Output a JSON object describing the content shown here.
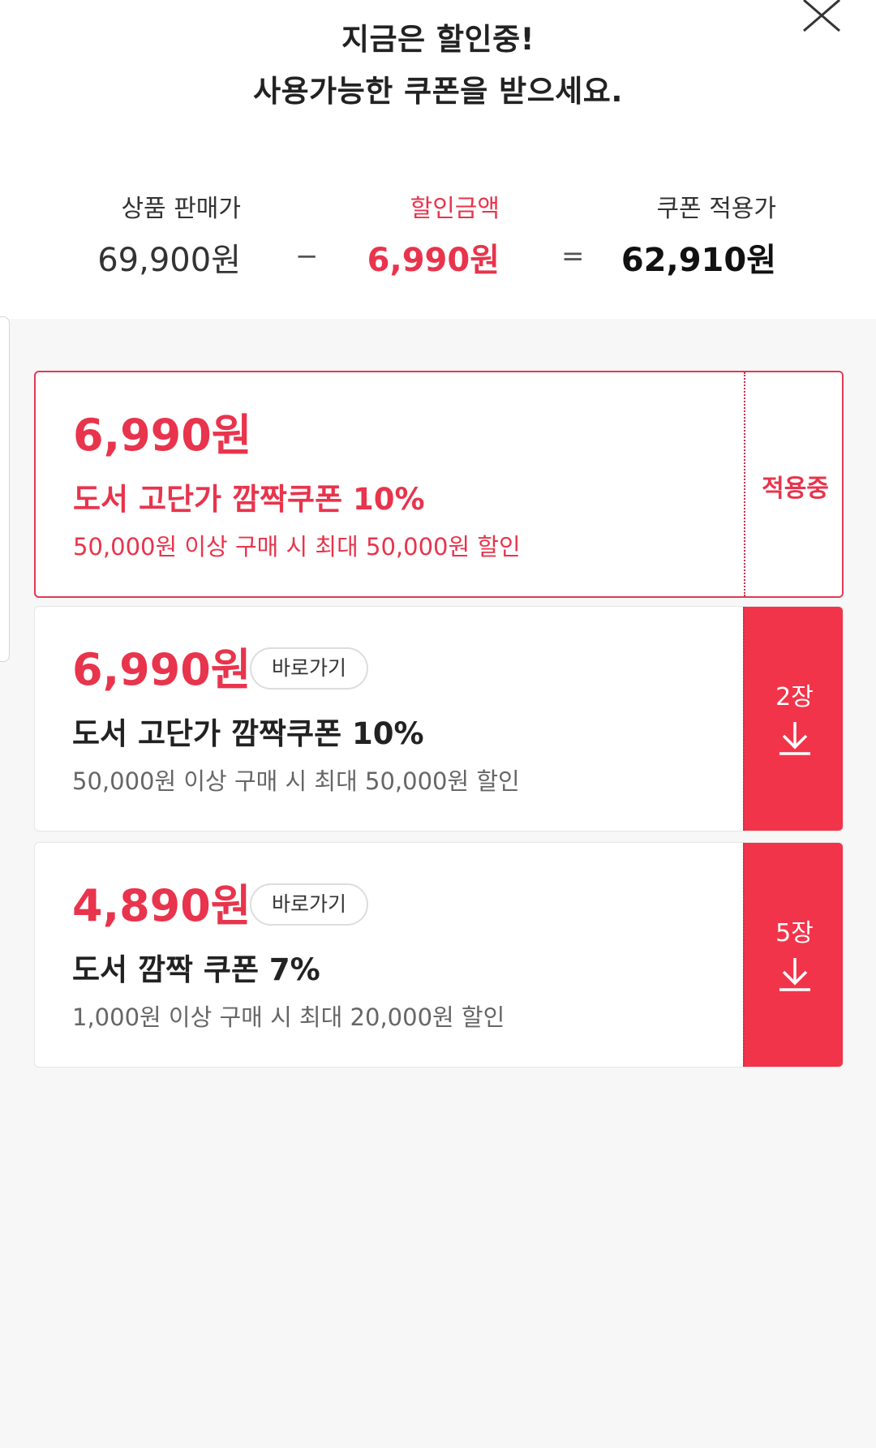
{
  "header": {
    "title_line1": "지금은 할인중!",
    "title_line2": "사용가능한 쿠폰을 받으세요.",
    "close_icon": "close-icon"
  },
  "price_summary": {
    "sale_label": "상품 판매가",
    "sale_value": "69,900원",
    "minus": "−",
    "discount_label": "할인금액",
    "discount_value": "6,990원",
    "equals": "=",
    "final_label": "쿠폰 적용가",
    "final_value": "62,910원"
  },
  "coupons": [
    {
      "amount": "6,990원",
      "name": "도서 고단가 깜짝쿠폰 10%",
      "condition": "50,000원 이상 구매 시 최대 50,000원 할인",
      "status": "적용중"
    },
    {
      "amount": "6,990원",
      "goto_label": "바로가기",
      "name": "도서 고단가 깜짝쿠폰 10%",
      "condition": "50,000원 이상 구매 시 최대 50,000원 할인",
      "count": "2장",
      "icon": "download-icon"
    },
    {
      "amount": "4,890원",
      "goto_label": "바로가기",
      "name": "도서 깜짝 쿠폰 7%",
      "condition": "1,000원 이상 구매 시 최대 20,000원 할인",
      "count": "5장",
      "icon": "download-icon"
    }
  ],
  "colors": {
    "accent": "#e8344c",
    "download_bg": "#f2344a",
    "page_bg": "#f7f7f7"
  }
}
